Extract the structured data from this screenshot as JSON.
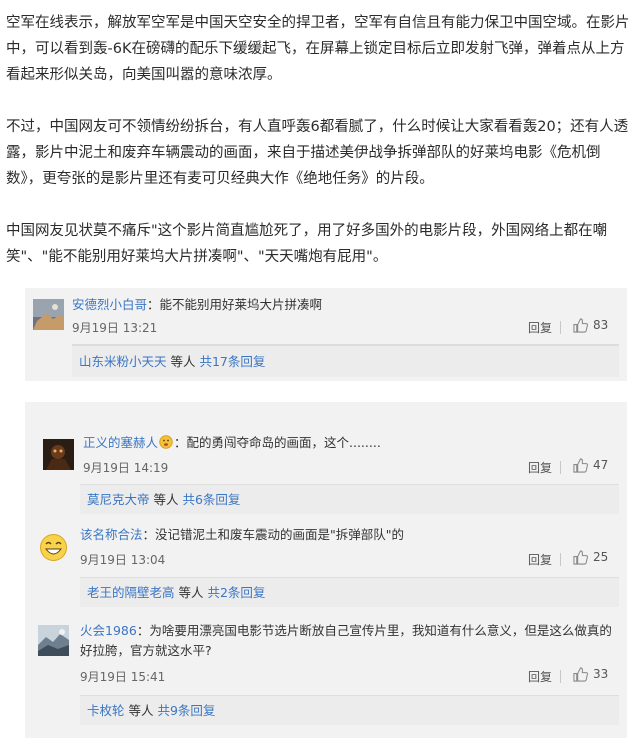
{
  "article": {
    "p1": "空军在线表示，解放军空军是中国天空安全的捍卫者，空军有自信且有能力保卫中国空域。在影片中，可以看到轰-6K在磅礴的配乐下缓缓起飞，在屏幕上锁定目标后立即发射飞弹，弹着点从上方看起来形似关岛，向美国叫嚣的意味浓厚。",
    "p2": "不过，中国网友可不领情纷纷拆台，有人直呼轰6都看腻了，什么时候让大家看看轰20；还有人透露，影片中泥土和废弃车辆震动的画面，来自于描述美伊战争拆弹部队的好莱坞电影《危机倒数》，更夸张的是影片里还有麦可贝经典大作《绝地任务》的片段。",
    "p3": "中国网友见状莫不痛斥\"这个影片简直尴尬死了，用了好多国外的电影片段，外国网络上都在嘲笑\"、\"能不能别用好莱坞大片拼凑啊\"、\"天天嘴炮有屁用\"。"
  },
  "comments": [
    {
      "user": "安德烈小白哥",
      "text": "：能不能别用好莱坞大片拼凑啊",
      "time": "9月19日 13:21",
      "reply_label": "回复",
      "likes": "83",
      "sub": {
        "user": "山东米粉小天天",
        "mid": " 等人 ",
        "count": "共17条回复"
      }
    },
    {
      "user": "正义的塞赫人",
      "badge_icon": "emoji-face-icon",
      "text": "：配的勇闯夺命岛的画面，这个........",
      "time": "9月19日 14:19",
      "reply_label": "回复",
      "likes": "47",
      "sub": {
        "user": "莫尼克大帝",
        "mid": " 等人 ",
        "count": "共6条回复"
      }
    },
    {
      "user": "该名称合法",
      "text": "：没记错泥土和废车震动的画面是\"拆弹部队\"的",
      "time": "9月19日 13:04",
      "reply_label": "回复",
      "likes": "25",
      "sub": {
        "user": "老王的隔壁老高",
        "mid": " 等人 ",
        "count": "共2条回复"
      }
    },
    {
      "user": "火会1986",
      "text": "：为啥要用漂亮国电影节选片断放自己宣传片里，我知道有什么意义，但是这么做真的好拉胯，官方就这水平?",
      "time": "9月19日 15:41",
      "reply_label": "回复",
      "likes": "33",
      "sub": {
        "user": "卡枚轮",
        "mid": " 等人 ",
        "count": "共9条回复"
      }
    }
  ],
  "colors": {
    "link": "#3a76c4",
    "card_bg": "#f2f2f2"
  }
}
